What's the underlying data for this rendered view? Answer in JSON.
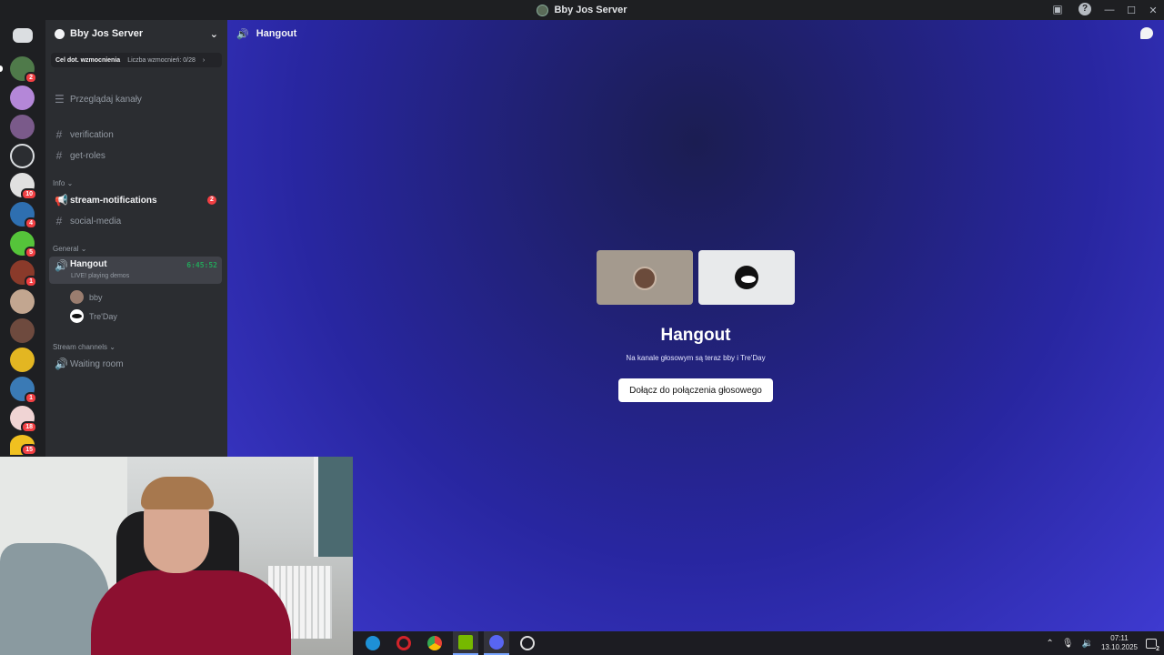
{
  "window": {
    "title": "Bby Jos Server"
  },
  "server": {
    "name": "Bby Jos Server",
    "boost_goal": "Cel dot. wzmocnienia",
    "boost_count": "Liczba wzmocnień: 0/28"
  },
  "server_list_badges": [
    "2",
    "10",
    "4",
    "5",
    "1",
    "1",
    "18",
    "15"
  ],
  "channels": {
    "browse": "Przeglądaj kanały",
    "verification": "verification",
    "get_roles": "get-roles",
    "cat_info": "Info",
    "stream_notifications": "stream-notifications",
    "stream_notifications_badge": "2",
    "social_media": "social-media",
    "cat_general": "General",
    "hangout": "Hangout",
    "hangout_timer": "6:45:52",
    "hangout_status": "LIVE! playing demos",
    "voice_user_1": "bby",
    "voice_user_2": "Tre'Day",
    "cat_stream": "Stream channels",
    "waiting_room": "Waiting room"
  },
  "main": {
    "header_title": "Hangout",
    "voice_title": "Hangout",
    "voice_subtitle": "Na kanale głosowym są teraz bby i Tre'Day",
    "join_button": "Dołącz do połączenia głosowego"
  },
  "taskbar": {
    "time": "07:11",
    "date": "13.10.2025",
    "notifications": "2"
  },
  "colors": {
    "accent": "#5865f2",
    "bg_main": "#2826a0",
    "unread": "#f23f43",
    "live": "#23a55a"
  }
}
